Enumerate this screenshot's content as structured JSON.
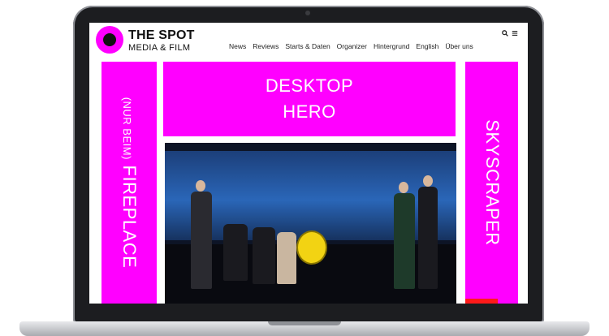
{
  "brand": {
    "title": "THE SPOT",
    "subtitle": "MEDIA & FILM",
    "accent": "#ff00ff"
  },
  "nav": {
    "items": [
      {
        "label": "News"
      },
      {
        "label": "Reviews"
      },
      {
        "label": "Starts & Daten"
      },
      {
        "label": "Organizer"
      },
      {
        "label": "Hintergrund"
      },
      {
        "label": "English"
      },
      {
        "label": "Über uns"
      }
    ]
  },
  "tools": {
    "search_icon": "search-icon",
    "menu_icon": "menu-icon"
  },
  "ads": {
    "hero_line1": "DESKTOP",
    "hero_line2": "HERO",
    "fireplace_prefix": "(NUR BEIM)",
    "fireplace_label": "FIREPLACE",
    "skyscraper_label": "SKYSCRAPER"
  },
  "colors": {
    "ad_slot": "#ff00ff",
    "laptop_bezel": "#1c1d20"
  }
}
